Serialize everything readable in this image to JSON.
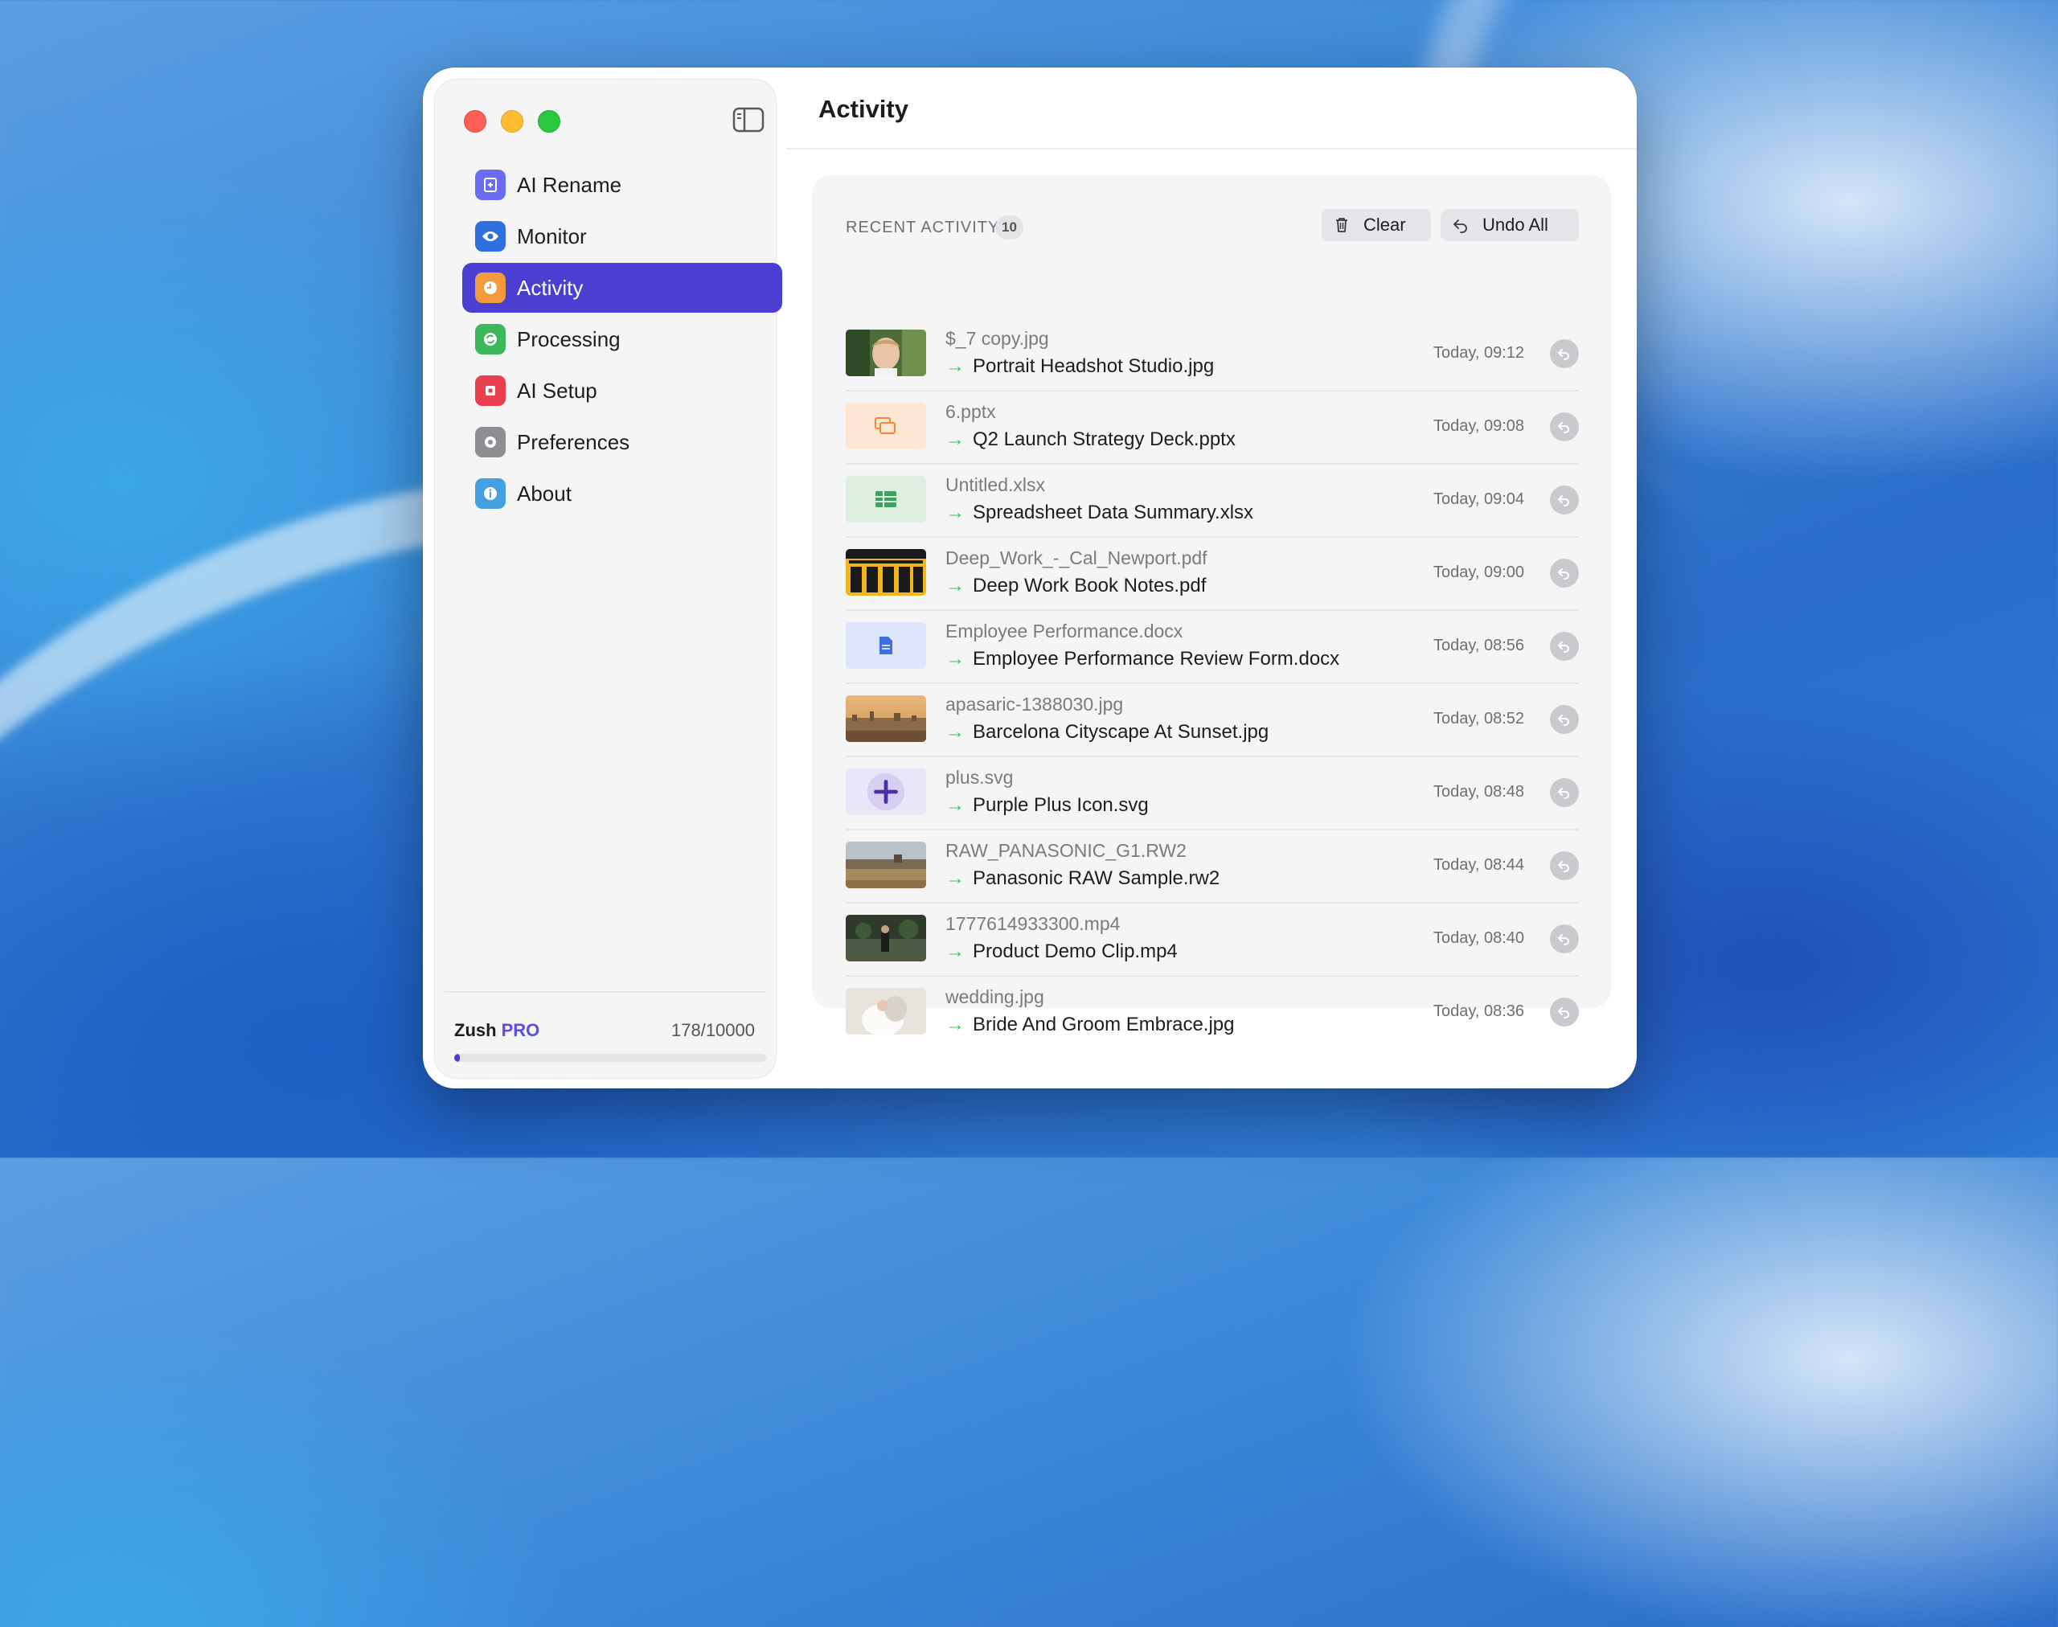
{
  "app": {
    "section_title": "Activity"
  },
  "sidebar": {
    "items": [
      {
        "label": "AI Rename",
        "icon": "ai-rename-icon",
        "color": "#6b6cf0",
        "active": false
      },
      {
        "label": "Monitor",
        "icon": "eye-icon",
        "color": "#2f6fe0",
        "active": false
      },
      {
        "label": "Activity",
        "icon": "clock-icon",
        "color": "#f39a3c",
        "active": true
      },
      {
        "label": "Processing",
        "icon": "refresh-icon",
        "color": "#3cb85a",
        "active": false
      },
      {
        "label": "AI Setup",
        "icon": "chip-icon",
        "color": "#e8404f",
        "active": false
      },
      {
        "label": "Preferences",
        "icon": "gear-icon",
        "color": "#8e8e93",
        "active": false
      },
      {
        "label": "About",
        "icon": "info-icon",
        "color": "#45a0e0",
        "active": false
      }
    ],
    "footer": {
      "plan_name": "Zush",
      "plan_tier": "PRO",
      "usage": "178/10000",
      "usage_fraction": 0.0178
    }
  },
  "activity": {
    "section_label": "RECENT ACTIVITY",
    "count": "10",
    "clear_label": "Clear",
    "undo_all_label": "Undo All",
    "rows": [
      {
        "original": "$_7 copy.jpg",
        "renamed": "Portrait Headshot Studio.jpg",
        "time": "Today, 09:12",
        "thumb": "portrait-photo"
      },
      {
        "original": "6.pptx",
        "renamed": "Q2 Launch Strategy Deck.pptx",
        "time": "Today, 09:08",
        "thumb": "pptx-icon"
      },
      {
        "original": "Untitled.xlsx",
        "renamed": "Spreadsheet Data Summary.xlsx",
        "time": "Today, 09:04",
        "thumb": "xlsx-icon"
      },
      {
        "original": "Deep_Work_-_Cal_Newport.pdf",
        "renamed": "Deep Work Book Notes.pdf",
        "time": "Today, 09:00",
        "thumb": "book-cover"
      },
      {
        "original": "Employee Performance.docx",
        "renamed": "Employee Performance Review Form.docx",
        "time": "Today, 08:56",
        "thumb": "docx-icon"
      },
      {
        "original": "apasaric-1388030.jpg",
        "renamed": "Barcelona Cityscape At Sunset.jpg",
        "time": "Today, 08:52",
        "thumb": "city-photo"
      },
      {
        "original": "plus.svg",
        "renamed": "Purple Plus Icon.svg",
        "time": "Today, 08:48",
        "thumb": "plus-icon"
      },
      {
        "original": "RAW_PANASONIC_G1.RW2",
        "renamed": "Panasonic RAW Sample.rw2",
        "time": "Today, 08:44",
        "thumb": "landscape-photo"
      },
      {
        "original": "1777614933300.mp4",
        "renamed": "Product Demo Clip.mp4",
        "time": "Today, 08:40",
        "thumb": "video-frame"
      },
      {
        "original": "wedding.jpg",
        "renamed": "Bride And Groom Embrace.jpg",
        "time": "Today, 08:36",
        "thumb": "wedding-photo"
      }
    ]
  }
}
